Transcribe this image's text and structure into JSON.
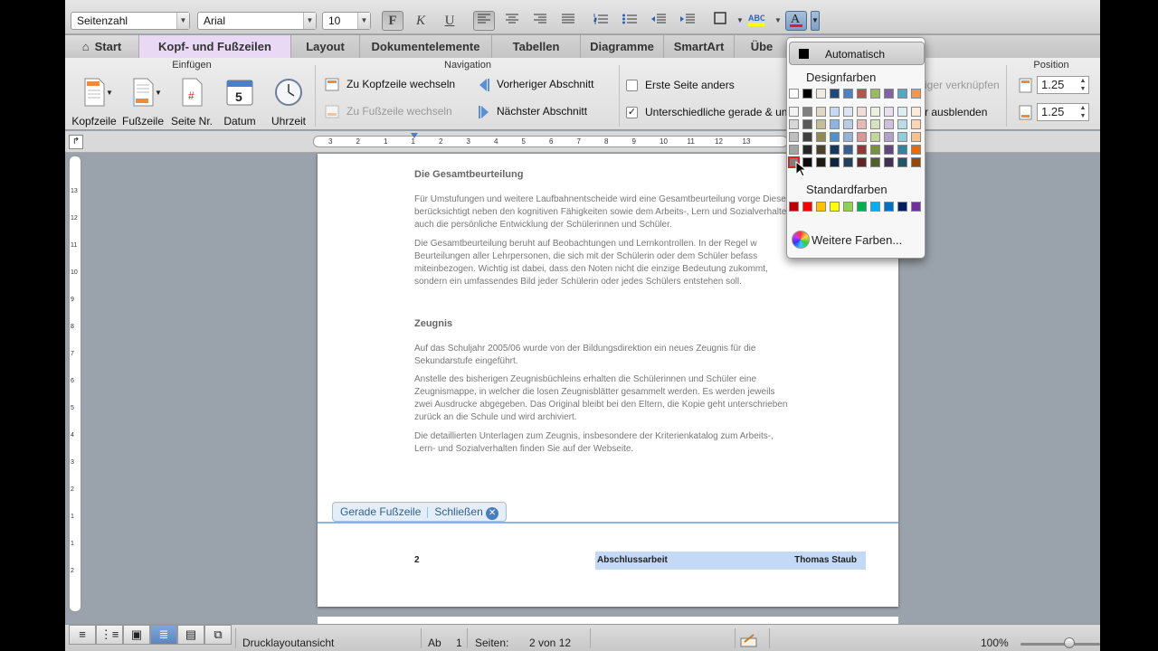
{
  "toolbar": {
    "style_select": "Seitenzahl",
    "font_select": "Arial",
    "size_select": "10",
    "bold": "F",
    "italic": "K",
    "underline": "U"
  },
  "tabs": [
    "Start",
    "Kopf- und Fußzeilen",
    "Layout",
    "Dokumentelemente",
    "Tabellen",
    "Diagramme",
    "SmartArt",
    "Übe"
  ],
  "ribbon": {
    "groups": {
      "insert": "Einfügen",
      "navigation": "Navigation",
      "position": "Position"
    },
    "insert_buttons": [
      "Kopfzeile",
      "Fußzeile",
      "Seite Nr.",
      "Datum",
      "Uhrzeit"
    ],
    "date_icon_num": "5",
    "nav_buttons": {
      "to_header": "Zu Kopfzeile wechseln",
      "to_footer": "Zu Fußzeile wechseln",
      "prev_section": "Vorheriger Abschnitt",
      "next_section": "Nächster Abschnitt"
    },
    "options": {
      "first_page": "Erste Seite anders",
      "odd_even": "Unterschiedliche gerade & un",
      "link_prev": "iger verknüpfen",
      "hide_text": "r ausblenden"
    },
    "position_values": [
      "1.25",
      "1.25"
    ]
  },
  "ruler_labels": [
    "3",
    "2",
    "1",
    "1",
    "2",
    "3",
    "4",
    "5",
    "6",
    "7",
    "8",
    "9",
    "10",
    "11",
    "12",
    "13"
  ],
  "vruler_labels": [
    "13",
    "12",
    "11",
    "10",
    "9",
    "8",
    "7",
    "6",
    "5",
    "4",
    "3",
    "2",
    "1",
    "1",
    "2"
  ],
  "document": {
    "heading1": "Die Gesamtbeurteilung",
    "para1": "Für Umstufungen und weitere Laufbahnentscheide wird eine Gesamtbeurteilung vorge Diese berücksichtigt neben den kognitiven Fähigkeiten sowie dem Arbeits-, Lern und Sozialverhalten auch die persönliche Entwicklung der Schülerinnen und Schüler.",
    "para2": "Die Gesamtbeurteilung beruht auf Beobachtungen und Lernkontrollen. In der Regel w Beurteilungen aller Lehrpersonen, die sich mit der Schülerin oder dem Schüler befass miteinbezogen. Wichtig ist dabei, dass den Noten nicht die einzige Bedeutung zukommt, sondern ein umfassendes Bild jeder Schülerin oder jedes Schülers entstehen soll.",
    "heading2": "Zeugnis",
    "para3": "Auf das Schuljahr 2005/06 wurde von der Bildungsdirektion ein neues Zeugnis für die Sekundarstufe eingeführt.",
    "para4": "Anstelle des bisherigen Zeugnisbüchleins erhalten die Schülerinnen und Schüler eine Zeugnismappe, in welcher die losen Zeugnisblätter gesammelt werden. Es werden jeweils zwei Ausdrucke abgegeben. Das Original bleibt bei den Eltern, die Kopie geht unterschrieben zurück an die Schule und wird archiviert.",
    "para5": "Die detaillierten Unterlagen zum Zeugnis, insbesondere der Kriterienkatalog zum Arbeits-, Lern- und Sozialverhalten finden Sie auf der Webseite.",
    "footer_tag": "Gerade Fußzeile",
    "footer_close": "Schließen",
    "footer_page": "2",
    "footer_title": "Abschlussarbeit",
    "footer_author": "Thomas Staub"
  },
  "color_popup": {
    "automatic": "Automatisch",
    "design_title": "Designfarben",
    "standard_title": "Standardfarben",
    "more_colors": "Weitere Farben...",
    "design_top": [
      "#ffffff",
      "#000000",
      "#eeece1",
      "#1f497d",
      "#4f81bd",
      "#c0504d",
      "#9bbb59",
      "#8064a2",
      "#4bacc6",
      "#f79646"
    ],
    "design_shades": [
      [
        "#f2f2f2",
        "#d8d8d8",
        "#bfbfbf",
        "#a5a5a5",
        "#7f7f7f"
      ],
      [
        "#7f7f7f",
        "#595959",
        "#3f3f3f",
        "#262626",
        "#0c0c0c"
      ],
      [
        "#ddd9c3",
        "#c4bd97",
        "#938953",
        "#494429",
        "#1d1b10"
      ],
      [
        "#c6d9f0",
        "#8db3e2",
        "#548dd4",
        "#17365d",
        "#0f243e"
      ],
      [
        "#dbe5f1",
        "#b8cce4",
        "#95b3d7",
        "#366092",
        "#244061"
      ],
      [
        "#f2dcdb",
        "#e5b9b7",
        "#d99694",
        "#953734",
        "#632423"
      ],
      [
        "#ebf1dd",
        "#d7e3bc",
        "#c3d69b",
        "#76923c",
        "#4f6128"
      ],
      [
        "#e5e0ec",
        "#ccc1d9",
        "#b2a2c7",
        "#5f497a",
        "#3f3151"
      ],
      [
        "#dbeef3",
        "#b7dde8",
        "#92cddc",
        "#31859b",
        "#205867"
      ],
      [
        "#fdeada",
        "#fbd5b5",
        "#fac08f",
        "#e36c09",
        "#974806"
      ]
    ],
    "standard": [
      "#c00000",
      "#ff0000",
      "#ffc000",
      "#ffff00",
      "#92d050",
      "#00b050",
      "#00b0f0",
      "#0070c0",
      "#002060",
      "#7030a0"
    ]
  },
  "status": {
    "view": "Drucklayoutansicht",
    "ab": "Ab",
    "ab_val": "1",
    "pages_label": "Seiten:",
    "pages_val": "2 von 12",
    "zoom": "100%"
  }
}
